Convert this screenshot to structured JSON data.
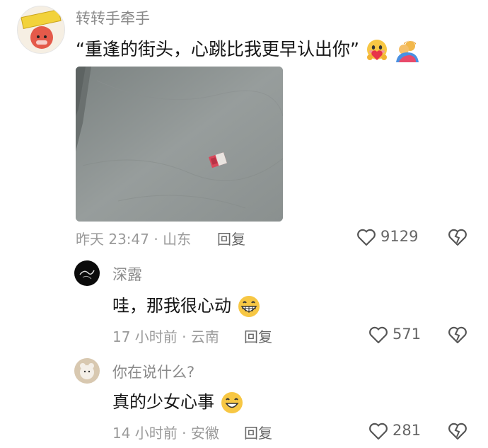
{
  "main_comment": {
    "user_name": "转转手牵手",
    "text": "“重逢的街头，心跳比我更早认出你”",
    "emojis": [
      "hug-face-heart-emoji",
      "hugging-people-emoji"
    ],
    "photo_desc": "concrete-ground-with-folded-banknote",
    "time_location": "昨天 23:47 · 山东",
    "reply_label": "回复",
    "like_count": "9129"
  },
  "replies": [
    {
      "user_name": "深露",
      "text": "哇，那我很心动",
      "emoji": "grinning-face-emoji",
      "time_location": "17 小时前 · 云南",
      "reply_label": "回复",
      "like_count": "571"
    },
    {
      "user_name": "你在说什么?",
      "text": "真的少女心事",
      "emoji": "smiling-face-emoji",
      "time_location": "14 小时前 · 安徽",
      "reply_label": "回复",
      "like_count": "281"
    }
  ],
  "colors": {
    "name": "#8a8a8a",
    "meta": "#9a9a9a",
    "text": "#161616",
    "icon": "#555555"
  }
}
